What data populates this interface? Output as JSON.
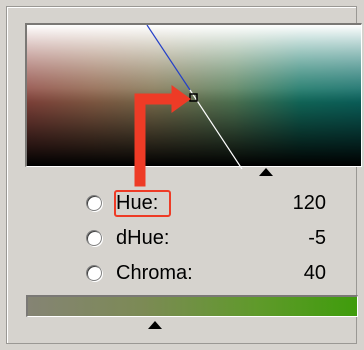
{
  "controls": {
    "hue": {
      "label": "Hue:",
      "value": "120"
    },
    "dhue": {
      "label": "dHue:",
      "value": "-5"
    },
    "chroma": {
      "label": "Chroma:",
      "value": "40"
    }
  },
  "selected_mode": "none",
  "icons": {
    "arrow": "red-pointer-arrow",
    "cursor": "square-cursor",
    "marker": "triangle-marker"
  },
  "colors": {
    "panel_bg": "#d6d3ce",
    "highlight": "#ee3b26",
    "bar_start": "#858474",
    "bar_end": "#3f9c0c"
  }
}
